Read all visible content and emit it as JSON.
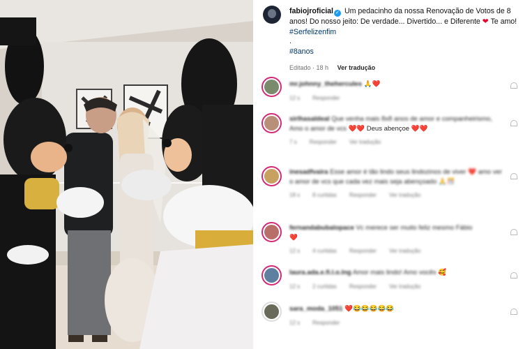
{
  "post": {
    "username": "fabiojroficial",
    "caption_text": "Um pedacinho da nossa Renovação de Votos de 8 anos! Do nosso jeito: De verdade... Divertido... e Diferente",
    "caption_tail": "Te amo!",
    "hashtag1": "#Serfelizenfim",
    "dot": ".",
    "hashtag2": "#8anos",
    "edited": "Editado · 18 h",
    "see_translation": "Ver tradução"
  },
  "comments": [
    {
      "user": "mr.johnny_thehercules",
      "text": "",
      "emoji": "🙏❤️",
      "meta": [
        "12 s",
        "Responder"
      ],
      "avatar_color": "#7a8a6d"
    },
    {
      "user": "sirlhasaldeal",
      "text": "Que venha mais 8x8 anos de amor e companheirismo, Amo o amor de vcs",
      "emoji": "❤️❤️ Deus abençoe ❤️❤️",
      "meta": [
        "7 s",
        "Responder",
        "Ver tradução"
      ],
      "avatar_color": "#b8907a"
    },
    {
      "user": "inesadfvaira",
      "text": "Esse amor é tão lindo seus lindozinos de viver",
      "emoji": "❤️ amo ver o amor de vcs que cada vez mais seja abençoado 🙏🎊",
      "meta": [
        "18 s",
        "8 curtidas",
        "Responder",
        "Ver tradução"
      ],
      "avatar_color": "#c8a060"
    },
    {
      "user": "fernandabubalopace",
      "text": "Vc merece ser muito feliz mesmo Fábio",
      "emoji": "❤️",
      "meta": [
        "12 s",
        "4 curtidas",
        "Responder",
        "Ver tradução"
      ],
      "avatar_color": "#b86f6a"
    },
    {
      "user": "laura.ada.e.fi.l.o.lng",
      "text": "Amor mais lindo! Amo vocês",
      "emoji": "🥰",
      "meta": [
        "12 s",
        "2 curtidas",
        "Responder",
        "Ver tradução"
      ],
      "avatar_color": "#5f7fa0"
    },
    {
      "user": "sara_moda_1051",
      "text": "",
      "emoji": "❤️😂😂😂😂😂",
      "meta": [
        "12 s",
        "Responder"
      ],
      "avatar_color": "#6a6a5a"
    }
  ]
}
